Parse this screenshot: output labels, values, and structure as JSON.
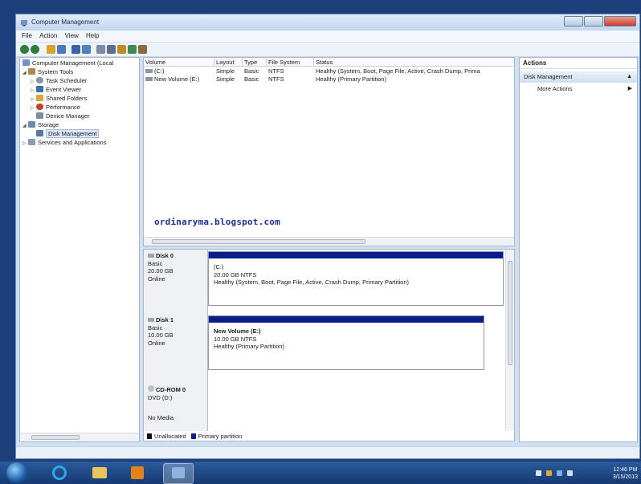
{
  "window": {
    "title": "Computer Management",
    "menu": [
      "File",
      "Action",
      "View",
      "Help"
    ]
  },
  "tree": {
    "root": "Computer Management (Local",
    "system_tools": "System Tools",
    "task_scheduler": "Task Scheduler",
    "event_viewer": "Event Viewer",
    "shared_folders": "Shared Folders",
    "performance": "Performance",
    "device_manager": "Device Manager",
    "storage": "Storage",
    "disk_management": "Disk Management",
    "services": "Services and Applications"
  },
  "volumes": {
    "headers": [
      "Volume",
      "Layout",
      "Type",
      "File System",
      "Status"
    ],
    "rows": [
      [
        "(C:)",
        "Simple",
        "Basic",
        "NTFS",
        "Healthy (System, Boot, Page File, Active, Crash Dump, Prima"
      ],
      [
        "New Volume (E:)",
        "Simple",
        "Basic",
        "NTFS",
        "Healthy (Primary Partition)"
      ]
    ]
  },
  "watermark": "ordinaryma.blogspot.com",
  "disks": {
    "disk0": {
      "name": "Disk 0",
      "type": "Basic",
      "size": "20.00 GB",
      "state": "Online",
      "part_name": "(C:)",
      "part_size": "20.00 GB NTFS",
      "part_status": "Healthy (System, Boot, Page File, Active, Crash Dump, Primary Partition)"
    },
    "disk1": {
      "name": "Disk 1",
      "type": "Basic",
      "size": "10.00 GB",
      "state": "Online",
      "part_name": "New Volume  (E:)",
      "part_size": "10.00 GB NTFS",
      "part_status": "Healthy (Primary Partition)"
    },
    "cdrom": {
      "name": "CD-ROM 0",
      "type": "DVD (D:)",
      "state": "No Media"
    }
  },
  "legend": {
    "unallocated": "Unallocated",
    "primary": "Primary partition"
  },
  "actions": {
    "header": "Actions",
    "section": "Disk Management",
    "more": "More Actions"
  },
  "clock": {
    "time": "12:46 PM",
    "date": "3/15/2013"
  },
  "colors": {
    "partition_bar": "#0b1d8c",
    "taskbar": "#1f4b8a"
  }
}
